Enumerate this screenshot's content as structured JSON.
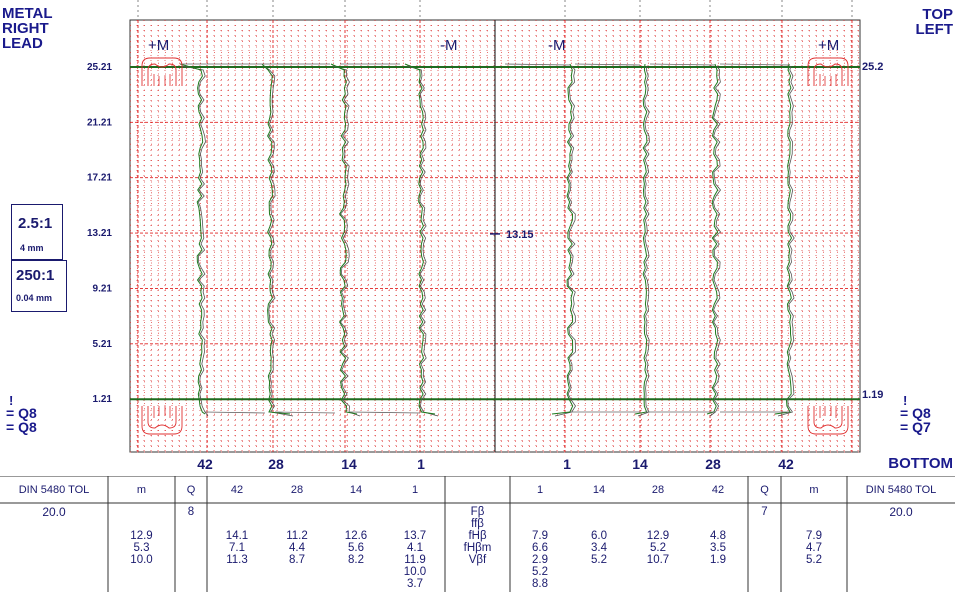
{
  "corners": {
    "top_left": [
      "METAL",
      "RIGHT",
      "LEAD"
    ],
    "top_right": [
      "TOP",
      "LEFT"
    ],
    "bottom_right": "BOTTOM"
  },
  "scale": {
    "h_ratio": "2.5:1",
    "h_unit": "4 mm",
    "v_ratio": "250:1",
    "v_unit": "0.04 mm"
  },
  "quality_left": [
    "Q8",
    "Q8"
  ],
  "quality_right": [
    "Q8",
    "Q7"
  ],
  "chart_data": {
    "type": "line",
    "y_ticks": [
      "25.21",
      "21.21",
      "17.21",
      "13.21",
      "9.21",
      "5.21",
      "1.21"
    ],
    "y_tick_values": [
      25.21,
      21.21,
      17.21,
      13.21,
      9.21,
      5.21,
      1.21
    ],
    "ylim": [
      -2.6,
      28.6
    ],
    "upper_limit_label": "25.2",
    "lower_limit_label": "1.19",
    "center_label": "13.15",
    "center_value": 13.15,
    "left_markers": [
      "+M",
      "-M"
    ],
    "right_markers": [
      "-M",
      "+M"
    ],
    "left_teeth": [
      "42",
      "28",
      "14",
      "1"
    ],
    "right_teeth": [
      "1",
      "14",
      "28",
      "42"
    ]
  },
  "table": {
    "left": {
      "tol_header": "DIN 5480 TOL",
      "tol_value": "20.0",
      "m_header": "m",
      "m_values": [
        "12.9",
        "5.3",
        "10.0"
      ],
      "q_header": "Q",
      "q_value": "8",
      "teeth": [
        {
          "tooth": "42",
          "values": [
            "14.1",
            "7.1",
            "11.3"
          ]
        },
        {
          "tooth": "28",
          "values": [
            "11.2",
            "4.4",
            "8.7"
          ]
        },
        {
          "tooth": "14",
          "values": [
            "12.6",
            "5.6",
            "8.2"
          ]
        },
        {
          "tooth": "1",
          "values": [
            "13.7",
            "4.1",
            "11.9",
            "10.0",
            "3.7"
          ]
        }
      ]
    },
    "params": [
      "Fβ",
      "ffβ",
      "fHβ",
      "fHβm",
      "Vβf"
    ],
    "right": {
      "teeth": [
        {
          "tooth": "1",
          "values": [
            "7.9",
            "6.6",
            "2.9",
            "5.2",
            "8.8"
          ]
        },
        {
          "tooth": "14",
          "values": [
            "6.0",
            "3.4",
            "5.2"
          ]
        },
        {
          "tooth": "28",
          "values": [
            "12.9",
            "5.2",
            "10.7"
          ]
        },
        {
          "tooth": "42",
          "values": [
            "4.8",
            "3.5",
            "1.9"
          ]
        }
      ],
      "q_header": "Q",
      "q_value": "7",
      "m_header": "m",
      "m_values": [
        "7.9",
        "4.7",
        "5.2"
      ],
      "tol_header": "DIN 5480 TOL",
      "tol_value": "20.0"
    }
  }
}
